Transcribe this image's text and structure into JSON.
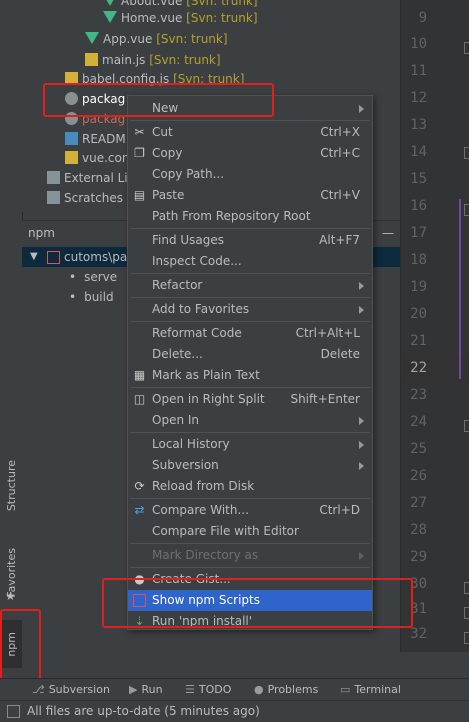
{
  "project_tree": {
    "items": [
      {
        "label": "About.vue",
        "svn": "[Svn: trunk]"
      },
      {
        "label": "Home.vue",
        "svn": "[Svn: trunk]"
      },
      {
        "label": "App.vue",
        "svn": "[Svn: trunk]"
      },
      {
        "label": "main.js",
        "svn": "[Svn: trunk]"
      },
      {
        "label": "babel.config.js",
        "svn": "[Svn: trunk]"
      },
      {
        "label": "packag"
      },
      {
        "label": "packag"
      },
      {
        "label": "READM"
      },
      {
        "label": "vue.con"
      },
      {
        "label": "External Lib"
      },
      {
        "label": "Scratches a"
      }
    ]
  },
  "npm_panel": {
    "title": "npm",
    "minimize": "—",
    "root": "cutoms\\pa",
    "scripts": [
      "serve",
      "build"
    ]
  },
  "side_tabs": {
    "structure": "Structure",
    "favorites": "Favorites",
    "npm": "npm"
  },
  "editor": {
    "line_numbers": [
      "9",
      "10",
      "11",
      "12",
      "13",
      "14",
      "15",
      "16",
      "17",
      "18",
      "19",
      "20",
      "21",
      "22",
      "23",
      "24",
      "25",
      "26",
      "27",
      "28",
      "29",
      "30",
      "31",
      "32"
    ]
  },
  "context_menu": {
    "new": "New",
    "cut": "Cut",
    "cut_sc": "Ctrl+X",
    "copy": "Copy",
    "copy_sc": "Ctrl+C",
    "copy_path": "Copy Path...",
    "paste": "Paste",
    "paste_sc": "Ctrl+V",
    "path_from_root": "Path From Repository Root",
    "find_usages": "Find Usages",
    "find_usages_sc": "Alt+F7",
    "inspect_code": "Inspect Code...",
    "refactor": "Refactor",
    "add_to_favorites": "Add to Favorites",
    "reformat_code": "Reformat Code",
    "reformat_code_sc": "Ctrl+Alt+L",
    "delete": "Delete...",
    "delete_sc": "Delete",
    "mark_plain_text": "Mark as Plain Text",
    "open_right_split": "Open in Right Split",
    "open_right_split_sc": "Shift+Enter",
    "open_in": "Open In",
    "local_history": "Local History",
    "subversion": "Subversion",
    "reload_from_disk": "Reload from Disk",
    "compare_with": "Compare With...",
    "compare_with_sc": "Ctrl+D",
    "compare_file_editor": "Compare File with Editor",
    "mark_directory_as": "Mark Directory as",
    "create_gist": "Create Gist...",
    "show_npm_scripts": "Show npm Scripts",
    "run_npm_install": "Run 'npm install'"
  },
  "bottom_tabs": {
    "subversion": "Subversion",
    "run": "Run",
    "todo": "TODO",
    "problems": "Problems",
    "terminal": "Terminal"
  },
  "status": {
    "text": "All files are up-to-date (5 minutes ago)"
  },
  "colors": {
    "background": "#3c3f41",
    "selection": "#2f65ca",
    "highlight_box": "#e0201c",
    "svn_label": "#b4a02c"
  }
}
